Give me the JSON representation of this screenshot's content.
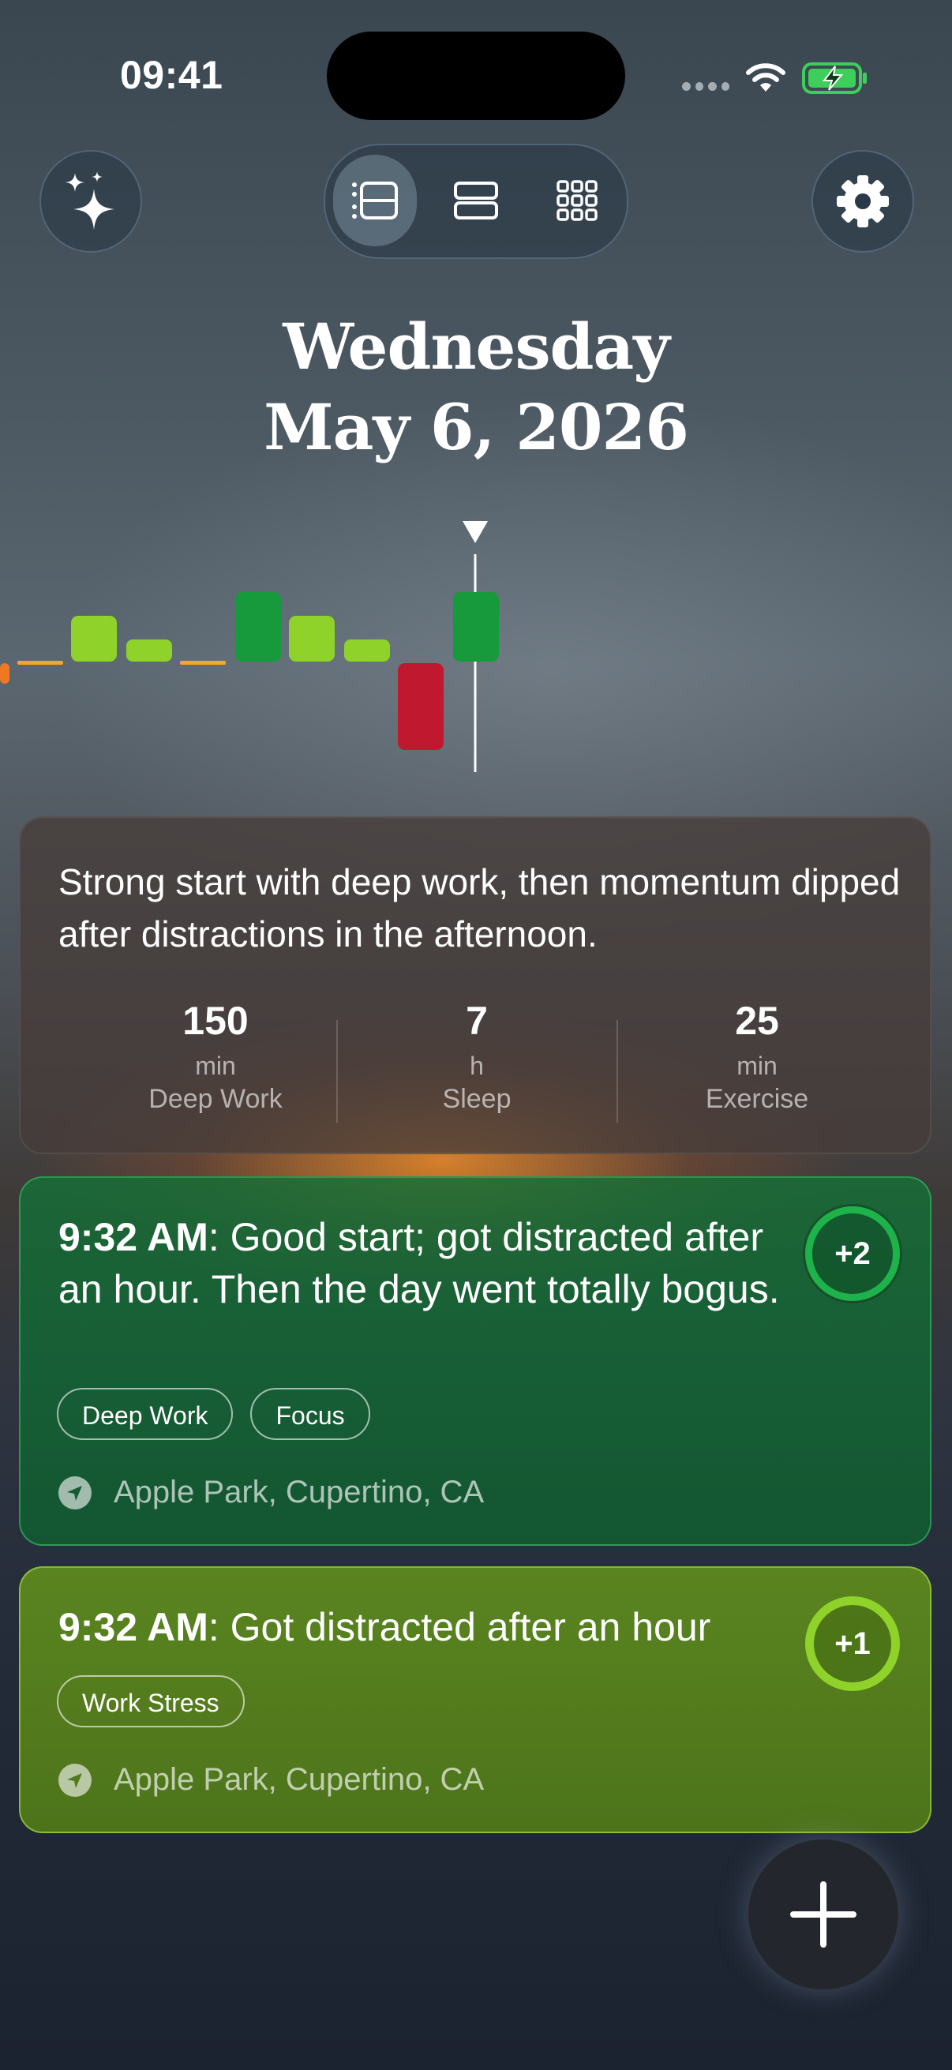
{
  "status_bar": {
    "time": "09:41"
  },
  "toolbar": {
    "left_icon": "sparkles-icon",
    "view_modes": [
      "list-timeline-icon",
      "rows-icon",
      "grid-icon"
    ],
    "active_view": 0,
    "right_icon": "gear-icon"
  },
  "header": {
    "weekday": "Wednesday",
    "date": "May 6, 2026"
  },
  "mood_timeline": {
    "description": "Bars above baseline positive, below negative; marker indicates current time",
    "colors": {
      "positive_strong": "#169a3c",
      "positive": "#8fd22a",
      "neutral": "#f5a623",
      "negative": "#c0182f",
      "orange": "#f07820"
    }
  },
  "summary": {
    "text": "Strong start with deep work, then momentum dipped after distractions in the afternoon.",
    "stats": [
      {
        "value": "150",
        "unit": "min",
        "label": "Deep Work"
      },
      {
        "value": "7",
        "unit": "h",
        "label": "Sleep"
      },
      {
        "value": "25",
        "unit": "min",
        "label": "Exercise"
      }
    ]
  },
  "entries": [
    {
      "time": "9:32 AM",
      "text": ": Good start; got distracted after an hour. Then the day went totally bogus.",
      "score": "+2",
      "tags": [
        "Deep Work",
        "Focus"
      ],
      "location": "Apple Park, Cupertino, CA"
    },
    {
      "time": "9:32 AM",
      "text": ": Got distracted after an hour",
      "score": "+1",
      "tags": [
        "Work Stress"
      ],
      "location": "Apple Park, Cupertino, CA"
    }
  ],
  "add_button": {
    "icon": "plus-icon"
  }
}
